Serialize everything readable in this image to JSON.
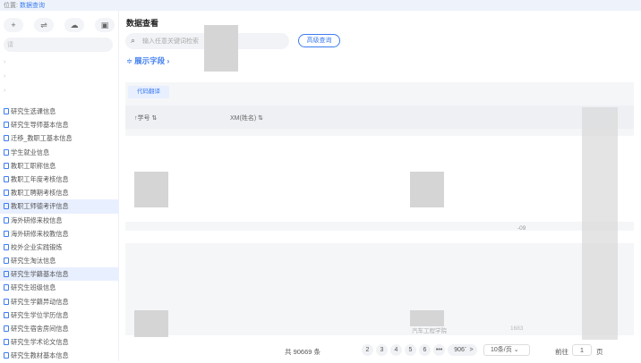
{
  "breadcrumb": {
    "prefix": "位置:",
    "current": "数据查询"
  },
  "sidebar": {
    "toolbar": [
      {
        "icon": "plus-icon",
        "glyph": "+"
      },
      {
        "icon": "swap-icon",
        "glyph": "⇌"
      },
      {
        "icon": "upload-icon",
        "glyph": "⌂"
      },
      {
        "icon": "delete-icon",
        "glyph": "▣"
      }
    ],
    "search_placeholder": "请",
    "items": [
      {
        "label": "研究生选课信息",
        "active": false
      },
      {
        "label": "研究生导师基本信息",
        "active": false
      },
      {
        "label": "迁移_教职工基本信息",
        "active": false
      },
      {
        "label": "学生就业信息",
        "active": false
      },
      {
        "label": "教职工职称信息",
        "active": false
      },
      {
        "label": "教职工年度考核信息",
        "active": false
      },
      {
        "label": "教职工聘期考核信息",
        "active": false
      },
      {
        "label": "教职工师德考评信息",
        "active": true
      },
      {
        "label": "海外研修来校信息",
        "active": false
      },
      {
        "label": "海外研修来校教信息",
        "active": false
      },
      {
        "label": "校外企业实践锻炼",
        "active": false
      },
      {
        "label": "研究生淘汰信息",
        "active": false
      },
      {
        "label": "研究生学籍基本信息",
        "active": true
      },
      {
        "label": "研究生班级信息",
        "active": false
      },
      {
        "label": "研究生学籍异动信息",
        "active": false
      },
      {
        "label": "研究生学位学历信息",
        "active": false
      },
      {
        "label": "研究生宿舍房间信息",
        "active": false
      },
      {
        "label": "研究生学术论文信息",
        "active": false
      },
      {
        "label": "研究生教材基本信息",
        "active": false
      }
    ]
  },
  "main": {
    "title": "数据查看",
    "search_placeholder": "输入任意关键词检索",
    "advanced_button": "高级查询",
    "fields_label": "展示字段",
    "code_button": "代码翻译",
    "columns": [
      "学号",
      "XM(姓名)"
    ],
    "cells": {
      "row_value_1": "汽车工程学院",
      "row_value_2": "1683",
      "row_value_3": "-09"
    },
    "pagination": {
      "total": "共 90669 条",
      "pages": [
        "2",
        "3",
        "4",
        "5",
        "6"
      ],
      "ellipsis": "•••",
      "last_page": "9067",
      "next": ">",
      "page_size": "10条/页",
      "goto_label": "前往",
      "goto_value": "1",
      "page_unit": "页"
    }
  }
}
